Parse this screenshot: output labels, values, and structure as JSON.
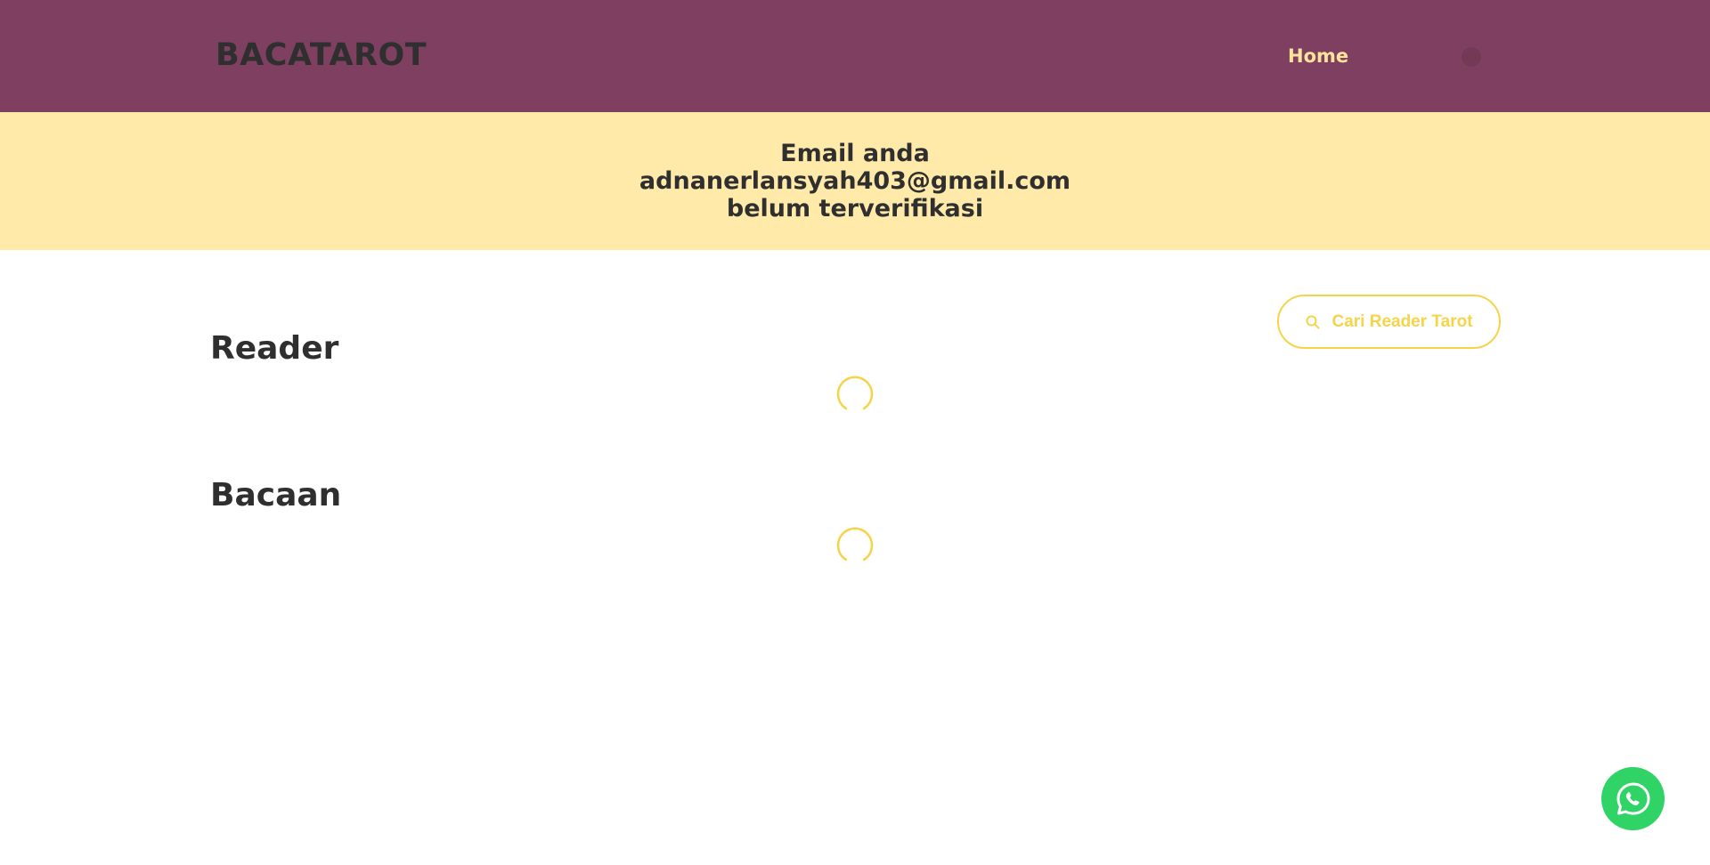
{
  "navbar": {
    "brand": "BACATAROT",
    "home_label": "Home",
    "avatar_icon": "user-avatar-icon"
  },
  "alert": {
    "line1": "Email anda",
    "line2": "adnanerlansyah403@gmail.com",
    "line3": "belum terverifikasi"
  },
  "reader": {
    "title": "Reader",
    "search_button_label": "Cari Reader Tarot",
    "search_icon": "search-icon"
  },
  "bacaan": {
    "title": "Bacaan"
  },
  "fab": {
    "icon": "whatsapp-icon"
  },
  "colors": {
    "navbar_bg": "#7f3f60",
    "banner_bg": "#ffeaaa",
    "accent": "#f5d44a",
    "home_text": "#ffe39a",
    "whatsapp": "#2fd366"
  }
}
